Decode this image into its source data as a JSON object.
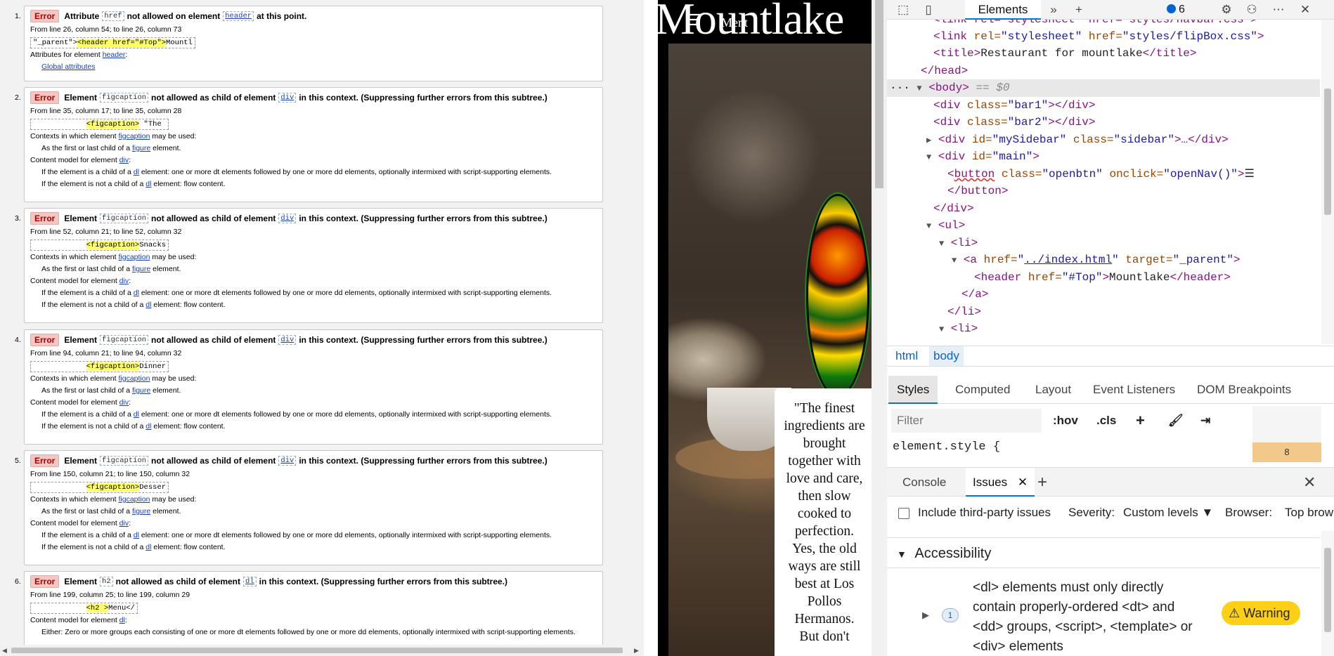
{
  "validator": {
    "errors": [
      {
        "num": "1.",
        "badge": "Error",
        "pre": "Attribute",
        "code1": "href",
        "mid": "not allowed on element",
        "code2": "header",
        "post": "at this point.",
        "loc": "From line 26, column 54; to line 26, column 73",
        "snip_pre": "\"_parent\">",
        "snip_hl": "<header href=\"#Top\">",
        "snip_post": "Mountl",
        "lines": [
          [
            "Attributes for element ",
            "header",
            ":"
          ],
          [
            "",
            "Global attributes",
            ""
          ]
        ]
      },
      {
        "num": "2.",
        "badge": "Error",
        "pre": "Element",
        "code1": "figcaption",
        "mid": "not allowed as child of element",
        "code2": "div",
        "post": "in this context. (Suppressing further errors from this subtree.)",
        "loc": "From line 35, column 17; to line 35, column 28",
        "snip_pre": "            ",
        "snip_hl": "<figcaption>",
        "snip_post": " \"The ",
        "lines": [
          [
            "Contexts in which element ",
            "figcaption",
            " may be used:"
          ],
          [
            "As the first or last child of a ",
            "figure",
            " element."
          ],
          [
            "Content model for element ",
            "div",
            ":"
          ],
          [
            "If the element is a child of a ",
            "dl",
            " element: one or more dt elements followed by one or more dd elements, optionally intermixed with script-supporting elements."
          ],
          [
            "If the element is not a child of a ",
            "dl",
            " element: flow content."
          ]
        ]
      },
      {
        "num": "3.",
        "badge": "Error",
        "pre": "Element",
        "code1": "figcaption",
        "mid": "not allowed as child of element",
        "code2": "div",
        "post": "in this context. (Suppressing further errors from this subtree.)",
        "loc": "From line 52, column 21; to line 52, column 32",
        "snip_pre": "            ",
        "snip_hl": "<figcaption>",
        "snip_post": "Snacks",
        "lines": [
          [
            "Contexts in which element ",
            "figcaption",
            " may be used:"
          ],
          [
            "As the first or last child of a ",
            "figure",
            " element."
          ],
          [
            "Content model for element ",
            "div",
            ":"
          ],
          [
            "If the element is a child of a ",
            "dl",
            " element: one or more dt elements followed by one or more dd elements, optionally intermixed with script-supporting elements."
          ],
          [
            "If the element is not a child of a ",
            "dl",
            " element: flow content."
          ]
        ]
      },
      {
        "num": "4.",
        "badge": "Error",
        "pre": "Element",
        "code1": "figcaption",
        "mid": "not allowed as child of element",
        "code2": "div",
        "post": "in this context. (Suppressing further errors from this subtree.)",
        "loc": "From line 94, column 21; to line 94, column 32",
        "snip_pre": "            ",
        "snip_hl": "<figcaption>",
        "snip_post": "Dinner",
        "lines": [
          [
            "Contexts in which element ",
            "figcaption",
            " may be used:"
          ],
          [
            "As the first or last child of a ",
            "figure",
            " element."
          ],
          [
            "Content model for element ",
            "div",
            ":"
          ],
          [
            "If the element is a child of a ",
            "dl",
            " element: one or more dt elements followed by one or more dd elements, optionally intermixed with script-supporting elements."
          ],
          [
            "If the element is not a child of a ",
            "dl",
            " element: flow content."
          ]
        ]
      },
      {
        "num": "5.",
        "badge": "Error",
        "pre": "Element",
        "code1": "figcaption",
        "mid": "not allowed as child of element",
        "code2": "div",
        "post": "in this context. (Suppressing further errors from this subtree.)",
        "loc": "From line 150, column 21; to line 150, column 32",
        "snip_pre": "            ",
        "snip_hl": "<figcaption>",
        "snip_post": "Desser",
        "lines": [
          [
            "Contexts in which element ",
            "figcaption",
            " may be used:"
          ],
          [
            "As the first or last child of a ",
            "figure",
            " element."
          ],
          [
            "Content model for element ",
            "div",
            ":"
          ],
          [
            "If the element is a child of a ",
            "dl",
            " element: one or more dt elements followed by one or more dd elements, optionally intermixed with script-supporting elements."
          ],
          [
            "If the element is not a child of a ",
            "dl",
            " element: flow content."
          ]
        ]
      },
      {
        "num": "6.",
        "badge": "Error",
        "pre": "Element",
        "code1": "h2",
        "mid": "not allowed as child of element",
        "code2": "dl",
        "post": "in this context. (Suppressing further errors from this subtree.)",
        "loc": "From line 199, column 25; to line 199, column 29",
        "snip_pre": "            ",
        "snip_hl": "<h2 >",
        "snip_post": "Menu</",
        "lines": [
          [
            "Content model for element ",
            "dl",
            ":"
          ],
          [
            "Either: Zero or more groups each consisting of one or more dt elements followed by one or more dd elements, optionally intermixed with script-supporting elements.",
            "",
            ""
          ]
        ]
      }
    ]
  },
  "site": {
    "title": "Mountlake",
    "menu_icon": "☰",
    "menu_text": "Ment",
    "quote": "\"The finest ingredients are brought together with love and care, then slow cooked to perfection. Yes, the old ways are still best at Los Pollos Hermanos. But don't"
  },
  "devtools": {
    "tab_elements": "Elements",
    "issues_count": "6",
    "dom_lines": {
      "l0": "<link rel=\"stylesheet\" href=\"styles/navbar.css\">",
      "l1_attr": "href=",
      "l1_val": "\"styles/flipBox.css\"",
      "title_text": "Restaurant for mountlake",
      "body_marker": "== $0",
      "div1": "\"bar1\"",
      "div2": "\"bar2\"",
      "side_id": "\"mySidebar\"",
      "side_class": "\"sidebar\"",
      "main_id": "\"main\"",
      "btn_class": "\"openbtn\"",
      "btn_onclick": "\"openNav()\"",
      "btn_text": "☰",
      "a_href": "../index.html",
      "a_target": "\"_parent\"",
      "h_href": "\"#Top\"",
      "h_text": "Mountlake"
    },
    "crumbs": [
      "html",
      "body"
    ],
    "style_tabs": [
      "Styles",
      "Computed",
      "Layout",
      "Event Listeners",
      "DOM Breakpoints"
    ],
    "filter_placeholder": "Filter",
    "hov": ":hov",
    "cls": ".cls",
    "element_style": "element.style {",
    "box_value": "8",
    "drawer_tabs": [
      "Console",
      "Issues"
    ],
    "third_party": "Include third-party issues",
    "severity_label": "Severity:",
    "severity_value": "Custom levels",
    "browser_label": "Browser:",
    "browser_value": "Top brow",
    "accessibility": "Accessibility",
    "issue_text": "<dl> elements must only directly contain properly-ordered <dt> and <dd> groups, <script>, <template> or <div> elements",
    "issue_count": "1",
    "warning": "Warning"
  }
}
